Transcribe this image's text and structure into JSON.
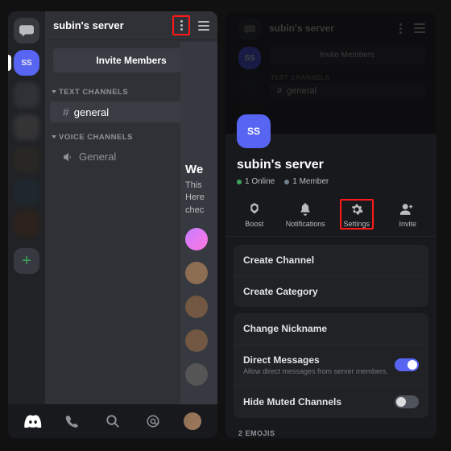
{
  "server": {
    "name": "subin's server",
    "initials": "SS"
  },
  "left": {
    "invite_label": "Invite Members",
    "cat_text": "TEXT CHANNELS",
    "cat_voice": "VOICE CHANNELS",
    "chan_general": "general",
    "chan_voice_general": "General",
    "welcome_title": "We",
    "welcome_line1": "This",
    "welcome_line2": "Here",
    "welcome_line3": "chec"
  },
  "right_dim": {
    "invite_label": "Invite Members",
    "cat_text": "TEXT CHANNELS",
    "chan_general": "general"
  },
  "sheet": {
    "server_name": "subin's server",
    "online": "1 Online",
    "members": "1 Member",
    "actions": {
      "boost": "Boost",
      "notifications": "Notifications",
      "settings": "Settings",
      "invite": "Invite"
    },
    "menu": {
      "create_channel": "Create Channel",
      "create_category": "Create Category",
      "change_nickname": "Change Nickname",
      "direct_messages": "Direct Messages",
      "direct_messages_sub": "Allow direct messages from server members.",
      "hide_muted": "Hide Muted Channels"
    },
    "emojis_label": "2 EMOJIS"
  }
}
